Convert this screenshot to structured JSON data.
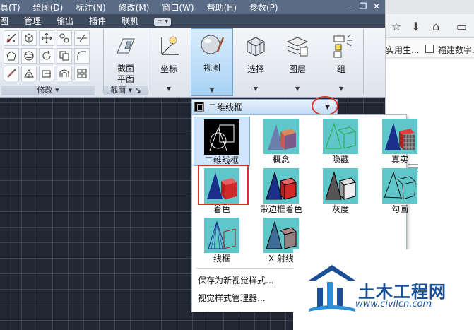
{
  "menu": {
    "items": [
      "具(T)",
      "绘图(D)",
      "标注(N)",
      "修改(M)",
      "窗口(W)",
      "帮助(H)",
      "参数(P)"
    ]
  },
  "ribbon": {
    "tabs": [
      "图",
      "管理",
      "输出",
      "插件",
      "联机"
    ],
    "panel_modify": "修改",
    "panel_section": "截面",
    "section_plane": "截面\n平面",
    "coords": "坐标",
    "view": "视图",
    "select": "选择",
    "layer": "图层",
    "group": "组"
  },
  "browser": {
    "bookmark1": "实用生...",
    "bookmark2": "福建数字..."
  },
  "visual_styles": {
    "current": "二维线框",
    "items": [
      {
        "label": "二维线框",
        "icon": "wireframe-2d-icon",
        "selected": true
      },
      {
        "label": "概念",
        "icon": "conceptual-icon"
      },
      {
        "label": "隐藏",
        "icon": "hidden-icon"
      },
      {
        "label": "真实",
        "icon": "realistic-icon"
      },
      {
        "label": "着色",
        "icon": "shaded-icon",
        "highlighted": true
      },
      {
        "label": "带边框着色",
        "icon": "shaded-edges-icon"
      },
      {
        "label": "灰度",
        "icon": "grayscale-icon"
      },
      {
        "label": "勾画",
        "icon": "sketchy-icon"
      },
      {
        "label": "线框",
        "icon": "wireframe-icon"
      },
      {
        "label": "X 射线",
        "icon": "xray-icon"
      }
    ],
    "save_as": "保存为新视觉样式...",
    "manager": "视觉样式管理器..."
  },
  "watermark": {
    "title": "土木工程网",
    "url": "www.civilcn.com"
  },
  "colors": {
    "accent": "#7ea4cf",
    "highlight_ring": "#e0322b",
    "thumb_bg": "#5fc7c9",
    "watermark_blue": "#1a4f96"
  }
}
